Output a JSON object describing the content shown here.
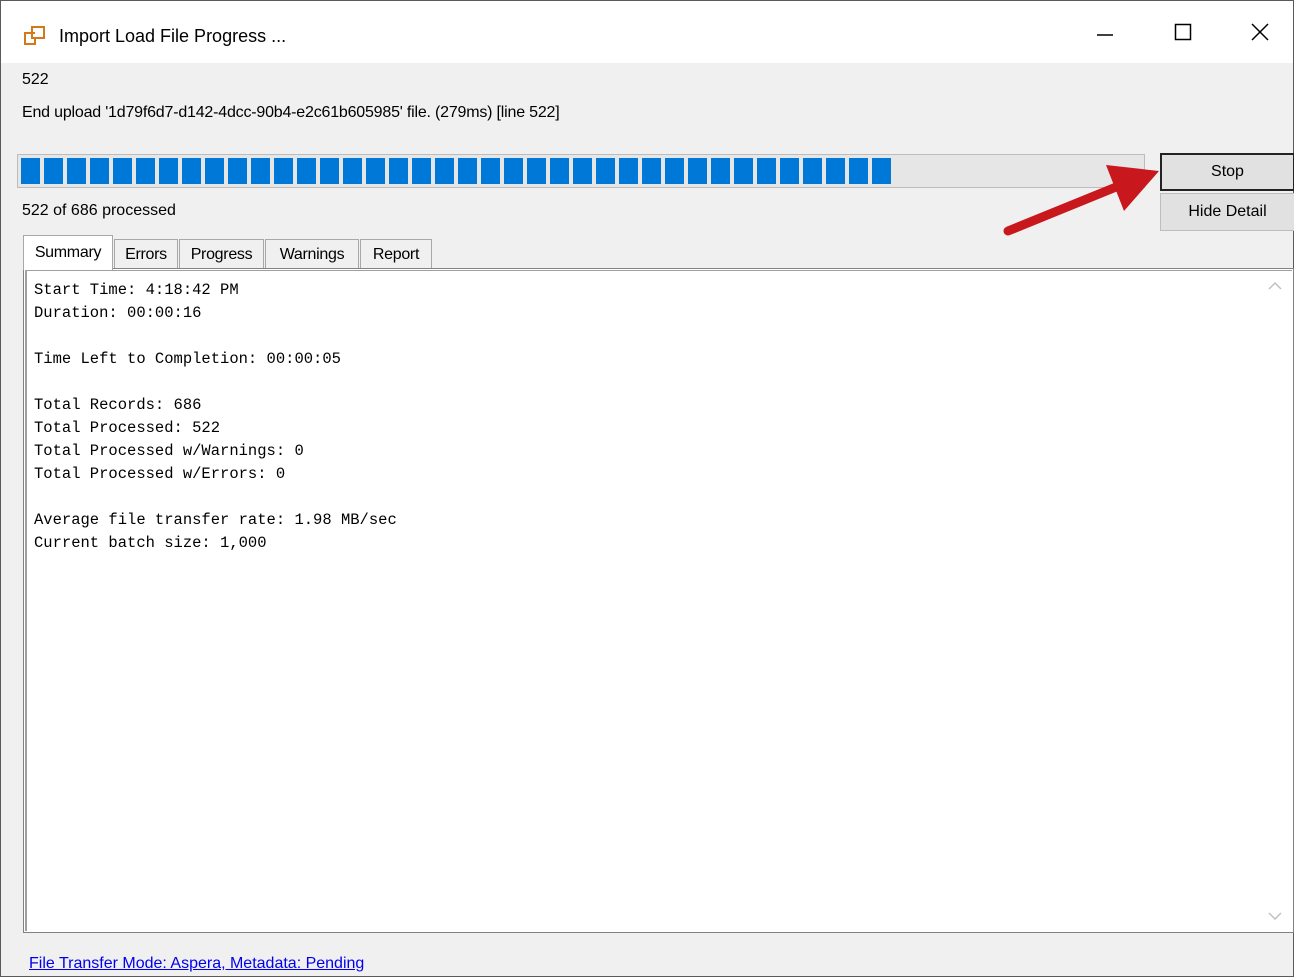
{
  "window": {
    "title": "Import Load File Progress ...",
    "icon": "import-windows-icon",
    "controls": [
      "minimize",
      "maximize",
      "close"
    ]
  },
  "status": {
    "current_line": "522",
    "message": "End upload '1d79f6d7-d142-4dcc-90b4-e2c61b605985' file. (279ms) [line 522]",
    "progress_fraction": 0.761,
    "processed_text": "522 of 686 processed"
  },
  "buttons": {
    "stop": "Stop",
    "hide_detail": "Hide Detail"
  },
  "tabs": [
    {
      "label": "Summary",
      "active": true
    },
    {
      "label": "Errors",
      "active": false
    },
    {
      "label": "Progress",
      "active": false
    },
    {
      "label": "Warnings",
      "active": false
    },
    {
      "label": "Report",
      "active": false
    }
  ],
  "summary_text": "Start Time: 4:18:42 PM\nDuration: 00:00:16\n\nTime Left to Completion: 00:00:05\n\nTotal Records: 686\nTotal Processed: 522\nTotal Processed w/Warnings: 0\nTotal Processed w/Errors: 0\n\nAverage file transfer rate: 1.98 MB/sec\nCurrent batch size: 1,000",
  "footer": {
    "link": "File Transfer Mode: Aspera, Metadata: Pending"
  },
  "colors": {
    "progress": "#0078d7",
    "annotation_arrow": "#c8181e",
    "link": "#0000ee"
  }
}
